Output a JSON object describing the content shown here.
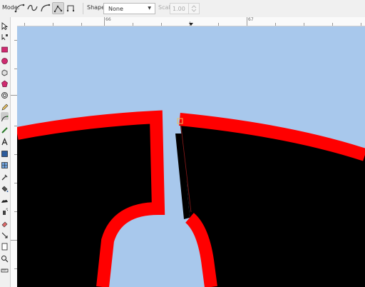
{
  "toolbar": {
    "mode_label": "Mode:",
    "mode_buttons": [
      {
        "name": "bezier-mode-icon",
        "active": false
      },
      {
        "name": "spiro-mode-icon",
        "active": false
      },
      {
        "name": "bspline-mode-icon",
        "active": false
      },
      {
        "name": "sequence-mode-icon",
        "active": true
      },
      {
        "name": "paraxial-mode-icon",
        "active": false
      }
    ],
    "shape_label": "Shape:",
    "shape_value": "None",
    "scale_label": "Scale:",
    "scale_value": "1.00"
  },
  "rulers": {
    "horizontal_labels": [
      "66",
      "67"
    ]
  },
  "tools": [
    "selector-icon",
    "node-icon",
    "rectangle-icon",
    "ellipse-icon",
    "box3d-icon",
    "star-icon",
    "spiral-icon",
    "pencil-icon",
    "pen-icon",
    "calligraphy-icon",
    "text-icon",
    "gradient-icon",
    "mesh-icon",
    "dropper-icon",
    "paint-bucket-icon",
    "tweak-icon",
    "spray-icon",
    "eraser-icon",
    "connector-icon",
    "pages-icon",
    "zoom-icon",
    "measure-icon"
  ],
  "colors": {
    "canvas_background": "#a8c8ec",
    "stroke": "#ff0000",
    "fill": "#000000",
    "accent": "#cf2a70"
  }
}
